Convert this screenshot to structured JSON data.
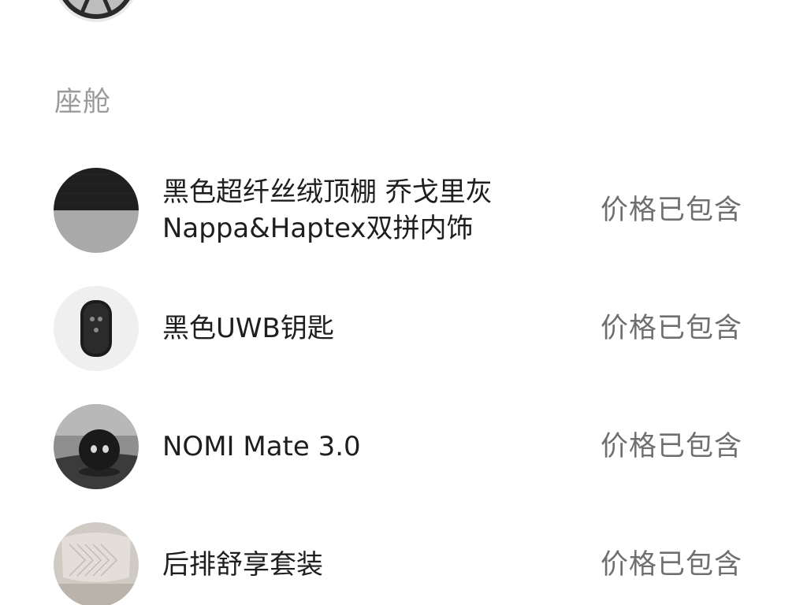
{
  "section": {
    "title": "座舱"
  },
  "items": [
    {
      "name": "黑色超纤丝绒顶棚 乔戈里灰\nNappa&Haptex双拼内饰",
      "price": "价格已包含",
      "icon": "headliner-swatch-icon"
    },
    {
      "name": "黑色UWB钥匙",
      "price": "价格已包含",
      "icon": "uwb-key-icon"
    },
    {
      "name": "NOMI Mate 3.0",
      "price": "价格已包含",
      "icon": "nomi-mate-icon"
    },
    {
      "name": "后排舒享套装",
      "price": "价格已包含",
      "icon": "rear-seat-icon"
    }
  ],
  "colors": {
    "section_title": "#9b9b9b",
    "item_name": "#1e1e1e",
    "price": "#6f6f6f",
    "swatch_dark": "#1f1f1f",
    "swatch_light": "#a9a9a9"
  }
}
